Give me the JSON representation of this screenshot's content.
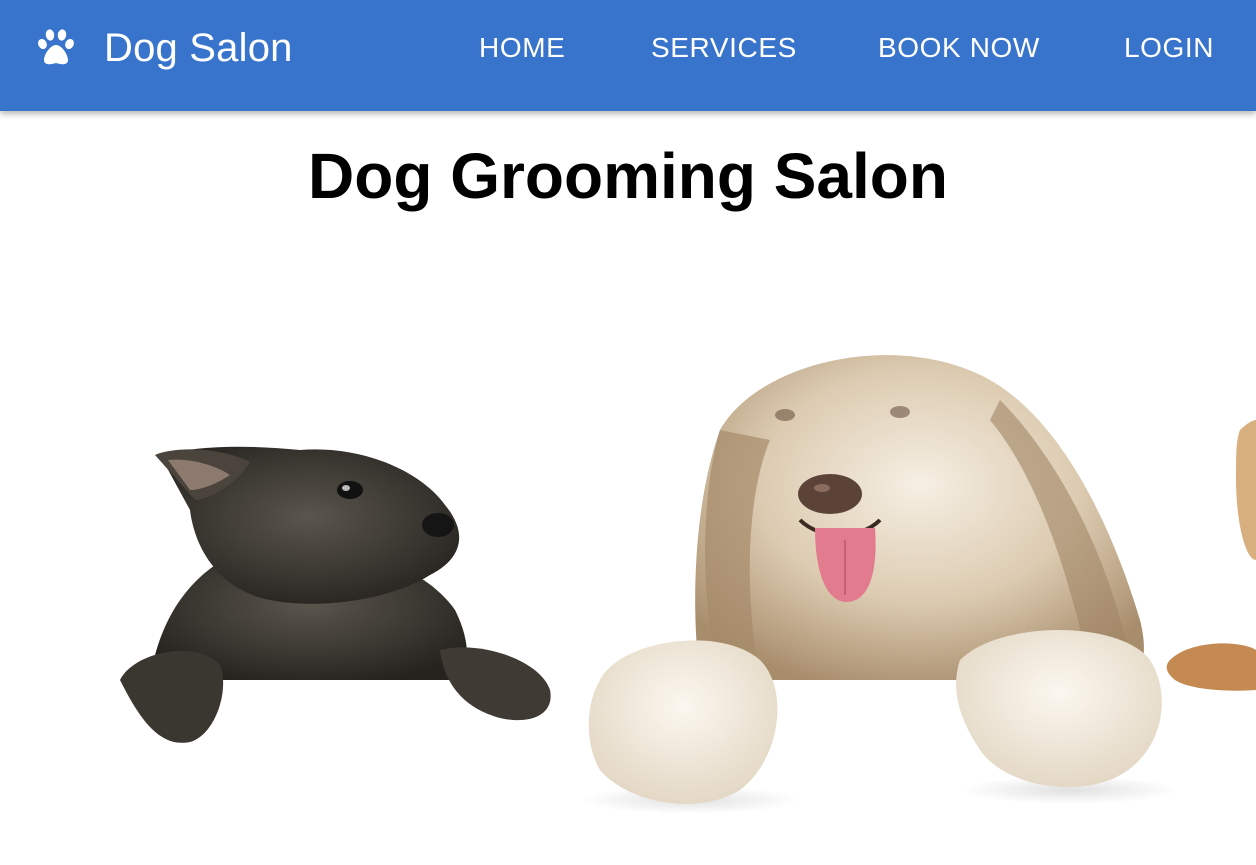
{
  "header": {
    "brand_icon": "paw-icon",
    "brand_title": "Dog Salon",
    "nav": {
      "home": "HOME",
      "services": "SERVICES",
      "book_now": "BOOK NOW",
      "login": "LOGIN"
    },
    "bar_color": "#3974cc"
  },
  "main": {
    "title": "Dog Grooming Salon",
    "hero_image": "dogs-peeking-over-ledge"
  }
}
